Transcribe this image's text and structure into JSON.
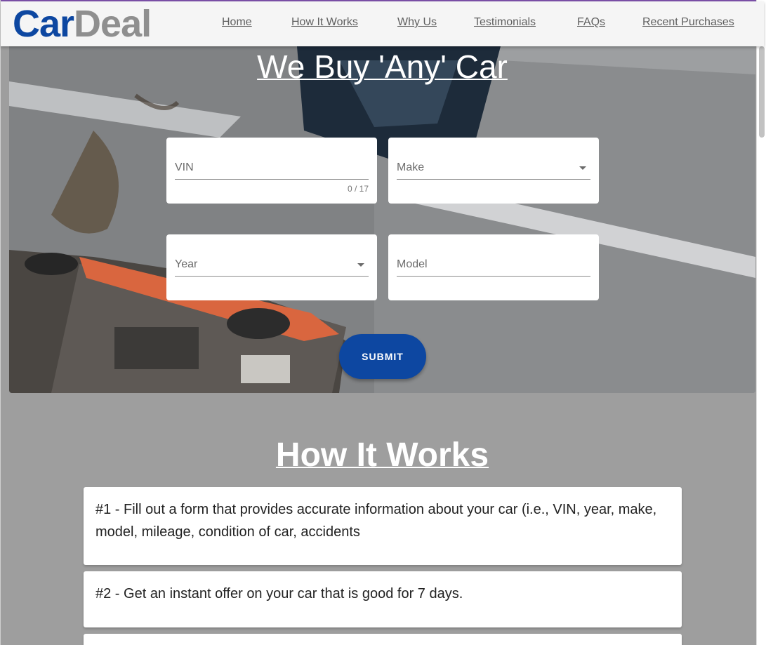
{
  "logo": {
    "part1": "Car",
    "part2": "Deal"
  },
  "nav": [
    {
      "label": "Home"
    },
    {
      "label": "How It Works"
    },
    {
      "label": "Why Us"
    },
    {
      "label": "Testimonials"
    },
    {
      "label": "FAQs"
    },
    {
      "label": "Recent Purchases"
    }
  ],
  "hero": {
    "title": "We Buy 'Any' Car",
    "vin_label": "VIN",
    "vin_counter": "0 / 17",
    "make_label": "Make",
    "year_label": "Year",
    "model_label": "Model",
    "submit_label": "SUBMIT"
  },
  "how_it_works": {
    "title": "How It Works",
    "steps": [
      {
        "text": "#1 - Fill out a form that provides accurate information about your car (i.e., VIN, year, make, model, mileage, condition of car, accidents"
      },
      {
        "text": "#2 - Get an instant offer on your car that is good for 7 days."
      }
    ]
  },
  "colors": {
    "brand_blue": "#0d47a1",
    "brand_gray": "#8f8f8f",
    "page_background": "#9e9e9e"
  }
}
